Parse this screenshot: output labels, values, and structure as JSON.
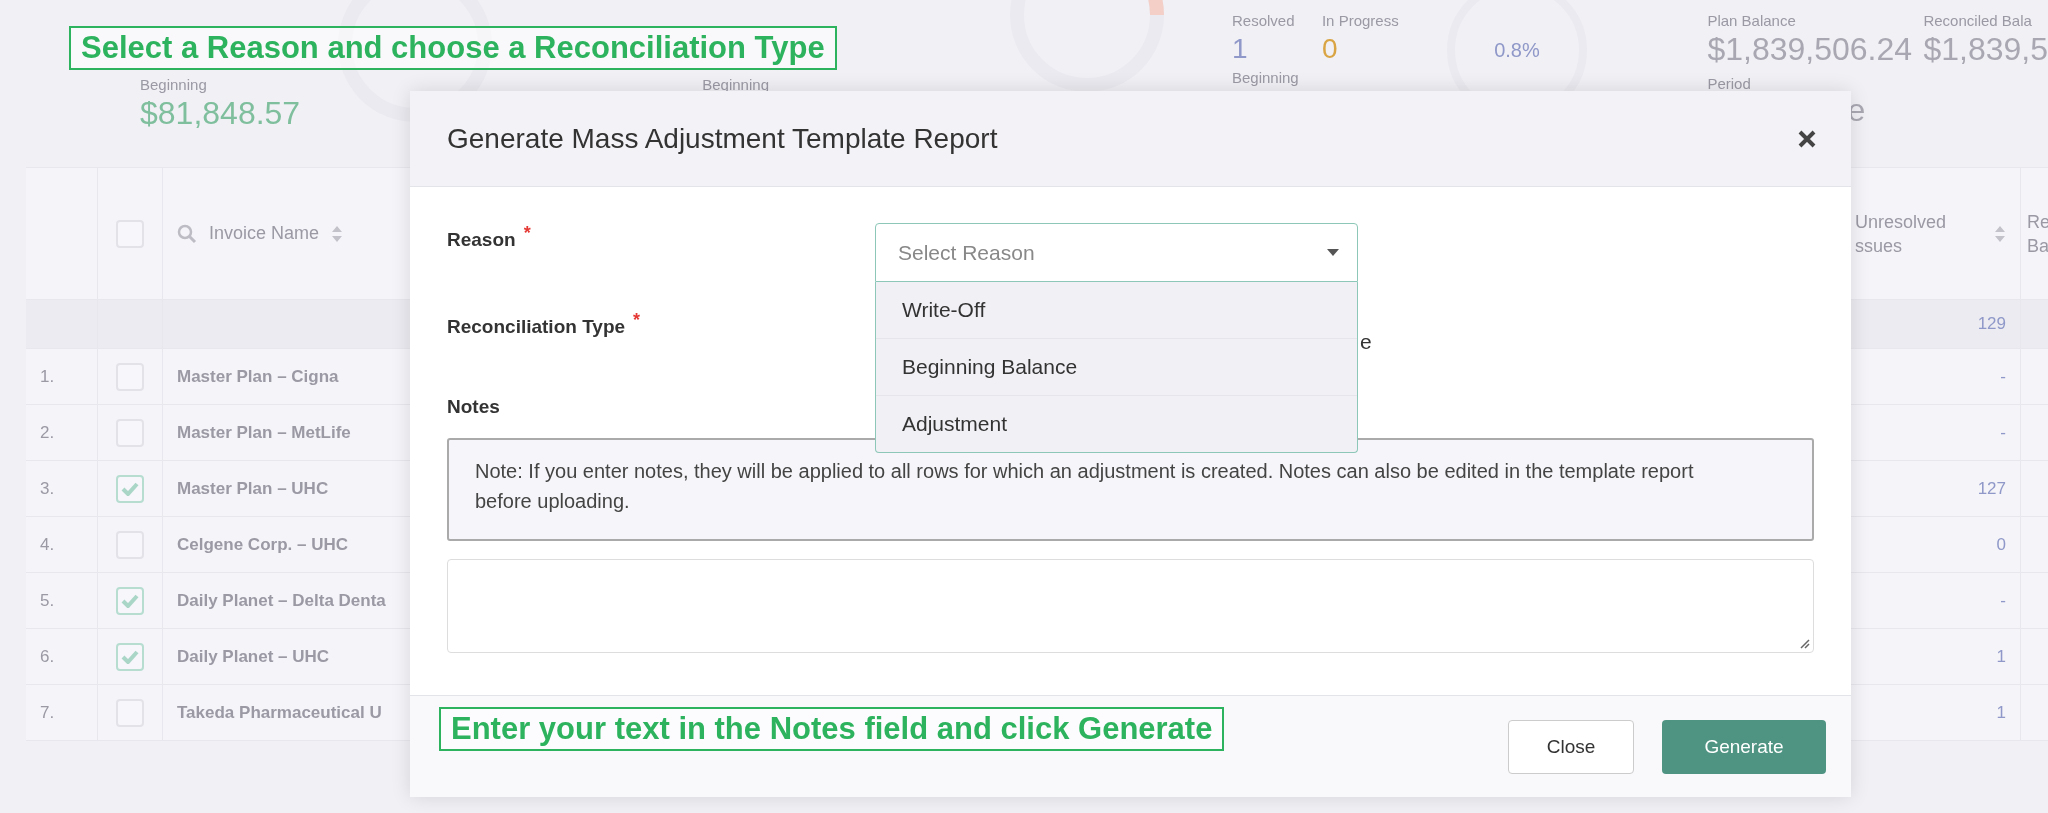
{
  "summary": {
    "cards": [
      {
        "label": "Beginning",
        "value": "$81,848.57"
      },
      {
        "label": "Beginning"
      }
    ],
    "resolved_label": "Resolved",
    "resolved_value": "1",
    "in_progress_label": "In Progress",
    "in_progress_value": "0",
    "beginning_label": "Beginning",
    "percent": "0.8%",
    "plan_balance_label": "Plan Balance",
    "plan_balance_value": "$1,839,506.24",
    "period_label": "Period",
    "period_fragment": "e",
    "reconciled_label": "Reconciled Bala",
    "reconciled_value": "$1,839,5"
  },
  "table": {
    "select_all_checked": false,
    "columns": [
      {
        "lines": [
          "Invoice Name"
        ]
      },
      {
        "lines": [
          "Unresolved",
          "ssues"
        ]
      },
      {
        "lines": [
          "Re",
          "Ba"
        ]
      }
    ],
    "summary_row": {
      "unresolved": "129"
    },
    "rows": [
      {
        "index": "1.",
        "checked": false,
        "name": "Master Plan – Cigna",
        "unresolved": "-"
      },
      {
        "index": "2.",
        "checked": false,
        "name": "Master Plan – MetLife",
        "unresolved": "-"
      },
      {
        "index": "3.",
        "checked": true,
        "name": "Master Plan – UHC",
        "unresolved": "127"
      },
      {
        "index": "4.",
        "checked": false,
        "name": "Celgene Corp. – UHC",
        "unresolved": "0"
      },
      {
        "index": "5.",
        "checked": true,
        "name": "Daily Planet – Delta Denta",
        "unresolved": "-"
      },
      {
        "index": "6.",
        "checked": true,
        "name": "Daily Planet – UHC",
        "unresolved": "1"
      },
      {
        "index": "7.",
        "checked": false,
        "name": "Takeda Pharmaceutical U",
        "unresolved": "1"
      }
    ]
  },
  "modal": {
    "title": "Generate Mass Adjustment Template Report",
    "reason": {
      "label": "Reason",
      "required_mark": "*",
      "placeholder": "Select Reason",
      "expanded": true,
      "options": [
        {
          "label": "Write-Off",
          "selected": false
        },
        {
          "label": "Beginning Balance",
          "selected": false
        },
        {
          "label": "Adjustment",
          "selected": false
        }
      ]
    },
    "reconciliation_type": {
      "label": "Reconciliation Type",
      "required_mark": "*",
      "visible_fragment": "e"
    },
    "notes": {
      "label": "Notes",
      "note": "Note: If you enter notes, they will be applied to all rows for which an adjustment is created. Notes can also be edited in the template report before uploading."
    },
    "buttons": [
      {
        "label": "Close",
        "kind": "secondary"
      },
      {
        "label": "Generate",
        "kind": "primary"
      }
    ]
  },
  "annotations": [
    {
      "text": "Select a Reason and choose a Reconciliation Type"
    },
    {
      "text": "Enter your text in the Notes field and click Generate"
    }
  ]
}
